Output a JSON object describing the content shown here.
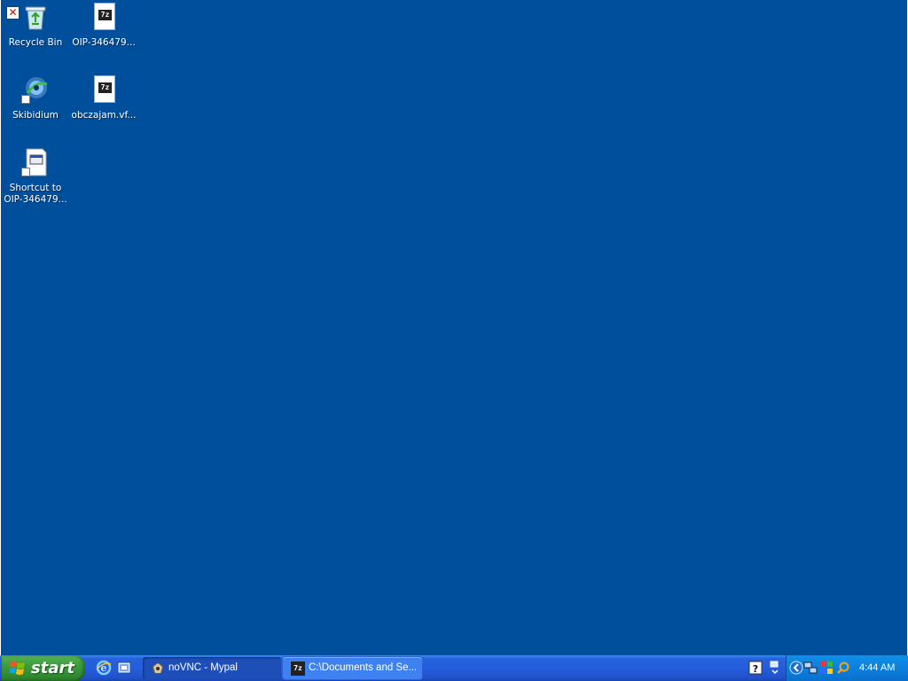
{
  "desktop": {
    "background_color": "#004f9c",
    "icons": [
      {
        "label": "Recycle Bin",
        "icon": "recycle-bin-icon"
      },
      {
        "label": "OIP-346479...",
        "icon": "7z-archive-icon"
      },
      {
        "label": "Skibidium",
        "icon": "skibidium-app-icon"
      },
      {
        "label": "obczajam.vf...",
        "icon": "7z-archive-icon"
      },
      {
        "label": "Shortcut to\nOIP-346479...",
        "icon": "shortcut-icon"
      }
    ]
  },
  "taskbar": {
    "start_label": "start",
    "quick_launch": [
      "internet-explorer-icon",
      "outlook-express-icon"
    ],
    "tasks": [
      {
        "label": "noVNC - Mypal",
        "icon": "mypal-browser-icon",
        "active": false
      },
      {
        "label": "C:\\Documents and Se...",
        "icon": "7z-app-icon",
        "active": true
      }
    ],
    "tray_icons": [
      "help-icon",
      "show-hidden-icons-chevron",
      "network-icon",
      "network-connection-icon",
      "security-center-icon",
      "search-icon"
    ],
    "clock": "4:44 AM"
  },
  "colors": {
    "taskbar_blue": "#245edb",
    "start_green": "#3c9c3c",
    "tray_blue": "#0c80de"
  }
}
